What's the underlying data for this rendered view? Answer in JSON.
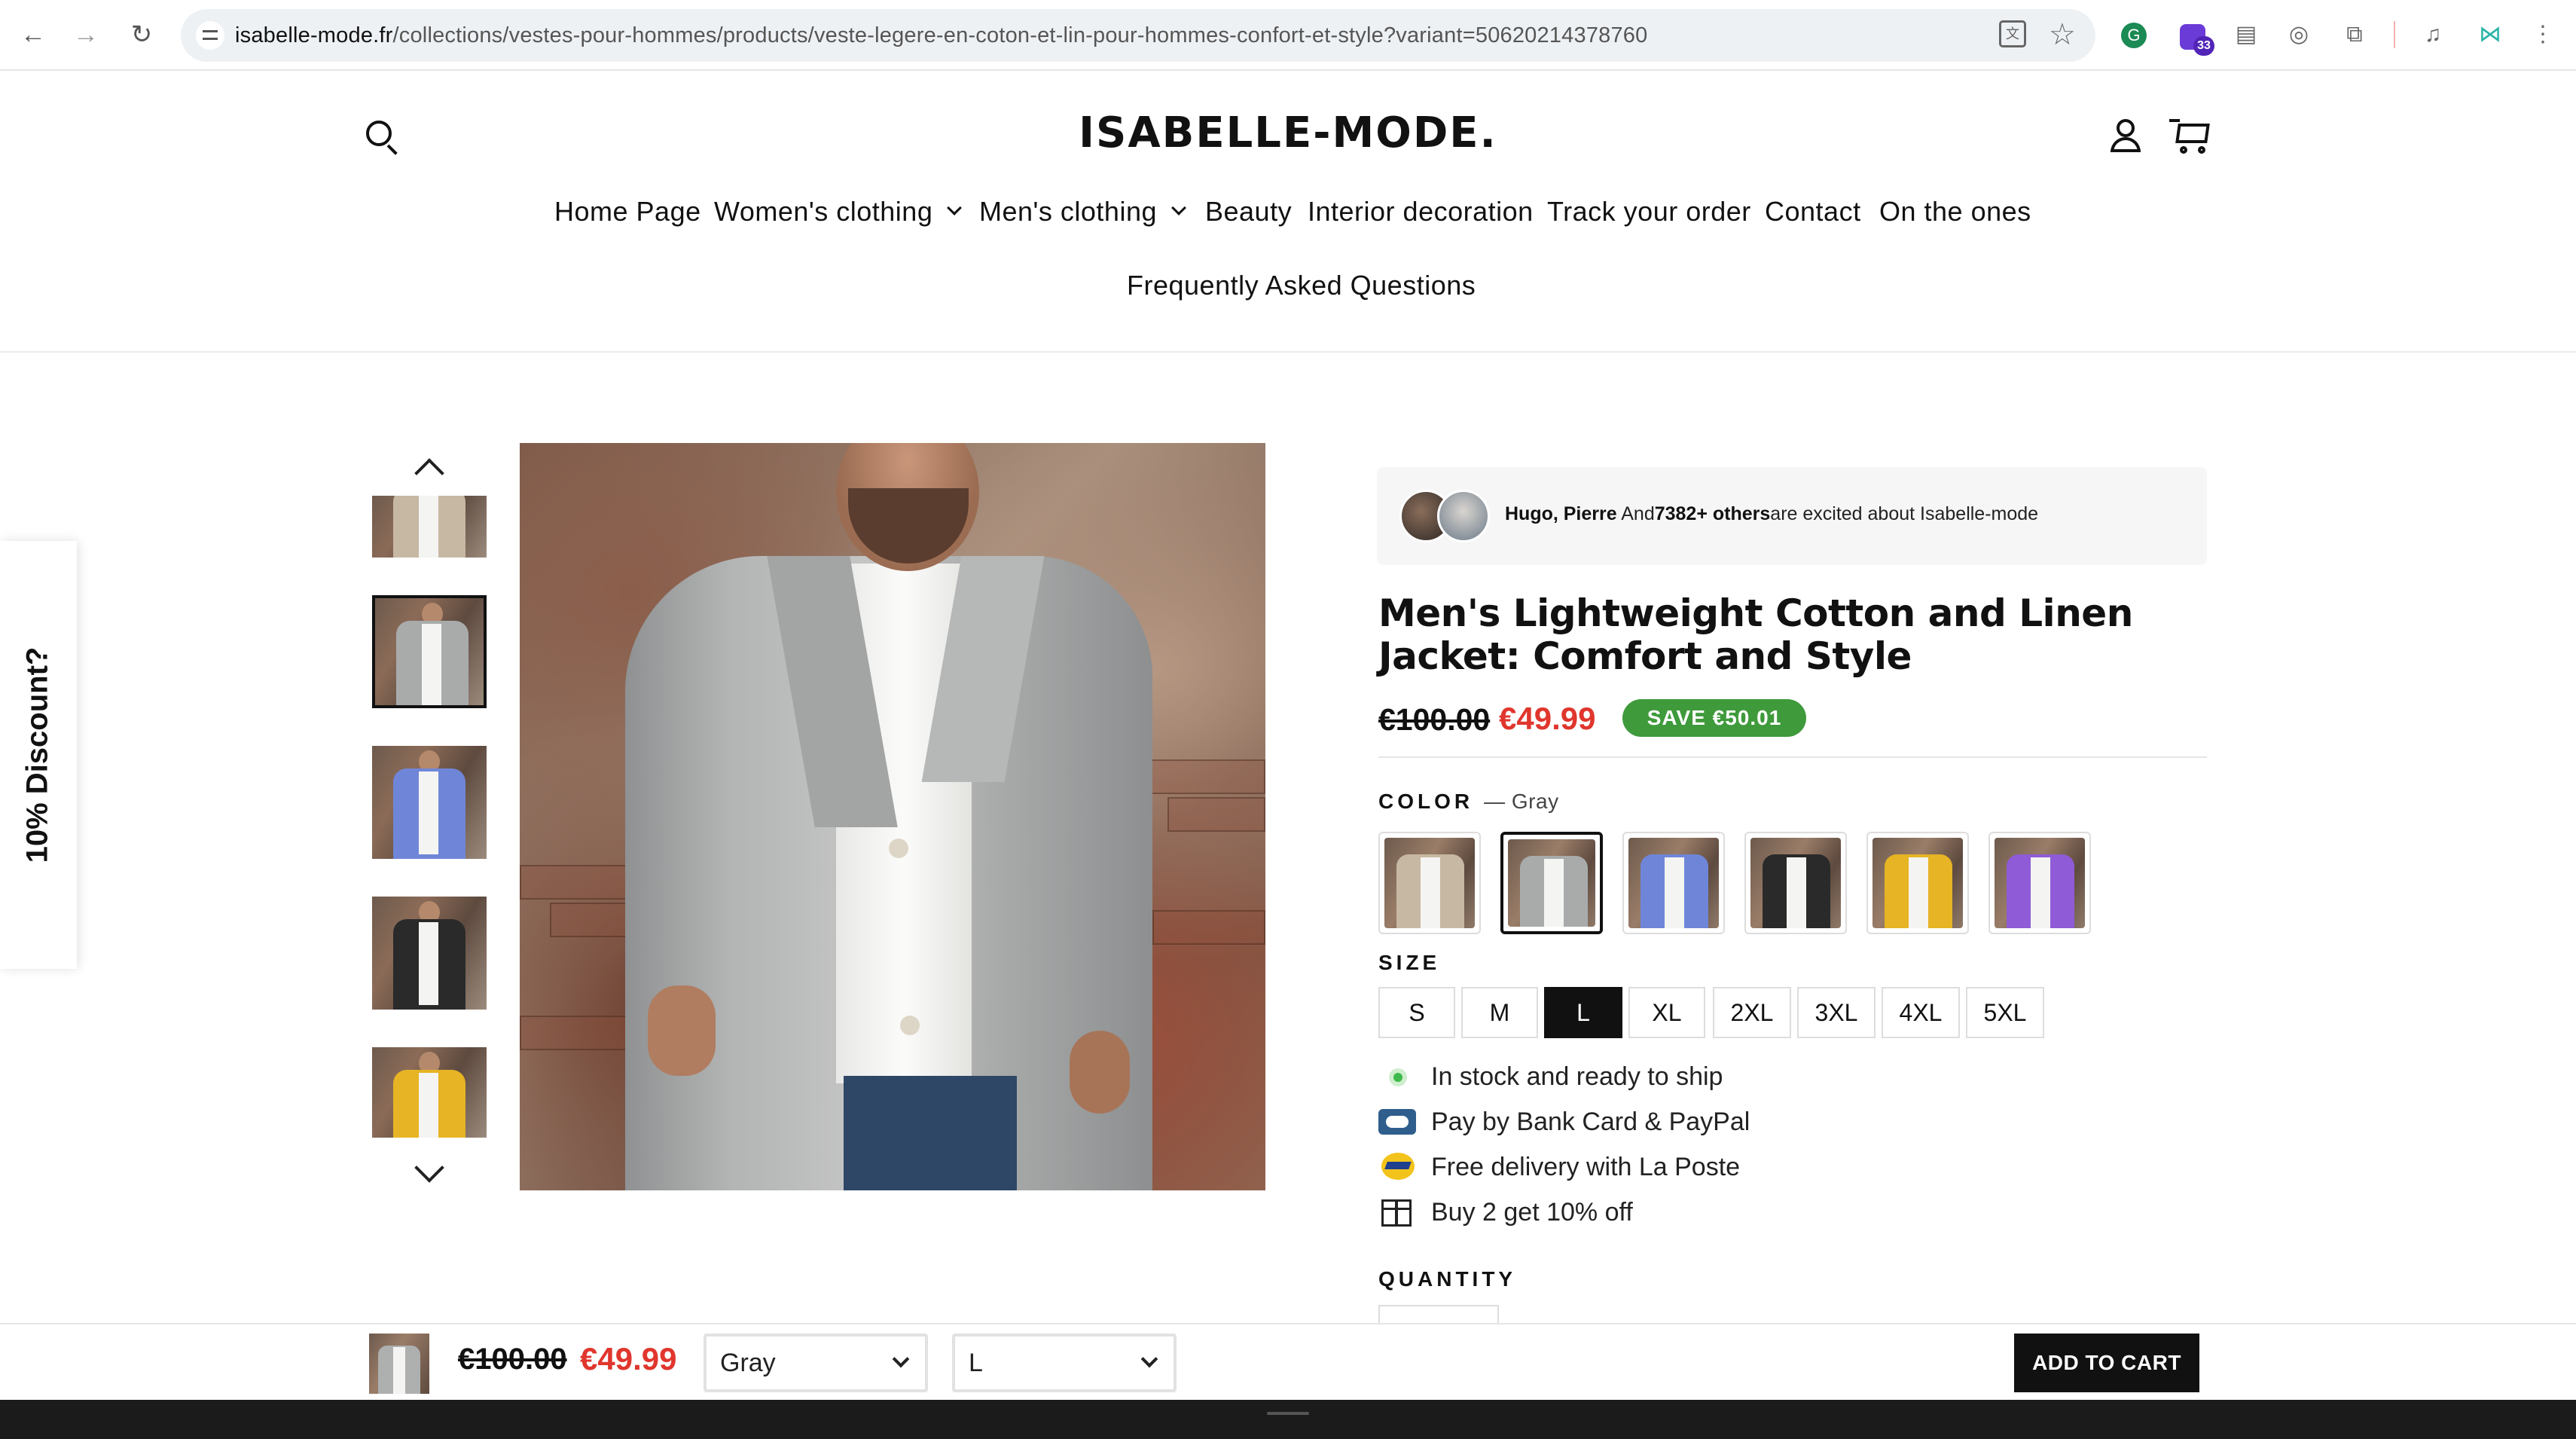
{
  "browser": {
    "url_host": "isabelle-mode.fr",
    "url_path": "/collections/vestes-pour-hommes/products/veste-legere-en-coton-et-lin-pour-hommes-confort-et-style?variant=50620214378760",
    "extension_badge": "33"
  },
  "header": {
    "logo": "ISABELLE-MODE.",
    "nav": [
      "Home Page",
      "Women's clothing",
      "Men's clothing",
      "Beauty",
      "Interior decoration",
      "Track your order",
      "Contact",
      "On the ones"
    ],
    "nav_row2": "Frequently Asked Questions"
  },
  "discount_tab": "10% Discount?",
  "gallery": {
    "jacket_colors": [
      "#c7b8a3",
      "#a9abab",
      "#6f86d8",
      "#2a2a2a",
      "#e6b424"
    ]
  },
  "social": {
    "names": "Hugo, Pierre",
    "and_text": "And",
    "count": "7382+ others",
    "suffix": "are excited about Isabelle-mode"
  },
  "product": {
    "title": "Men's Lightweight Cotton and Linen Jacket: Comfort and Style",
    "price_old": "€100.00",
    "price_new": "€49.99",
    "save_badge": "SAVE €50.01",
    "color_label": "COLOR",
    "color_value": "— Gray",
    "swatch_colors": [
      "#c7b8a3",
      "#a9abab",
      "#6f86d8",
      "#2a2a2a",
      "#e6b424",
      "#8f5bd6"
    ],
    "size_label": "SIZE",
    "sizes": [
      "S",
      "M",
      "L",
      "XL",
      "2XL",
      "3XL",
      "4XL",
      "5XL"
    ],
    "selected_size": "L",
    "features": [
      "In stock and ready to ship",
      "Pay by Bank Card & PayPal",
      "Free delivery with La Poste",
      "Buy 2 get 10% off"
    ],
    "quantity_label": "QUANTITY"
  },
  "sticky_bar": {
    "price_old": "€100.00",
    "price_new": "€49.99",
    "color_select": "Gray",
    "size_select": "L",
    "add_to_cart": "ADD TO CART"
  }
}
